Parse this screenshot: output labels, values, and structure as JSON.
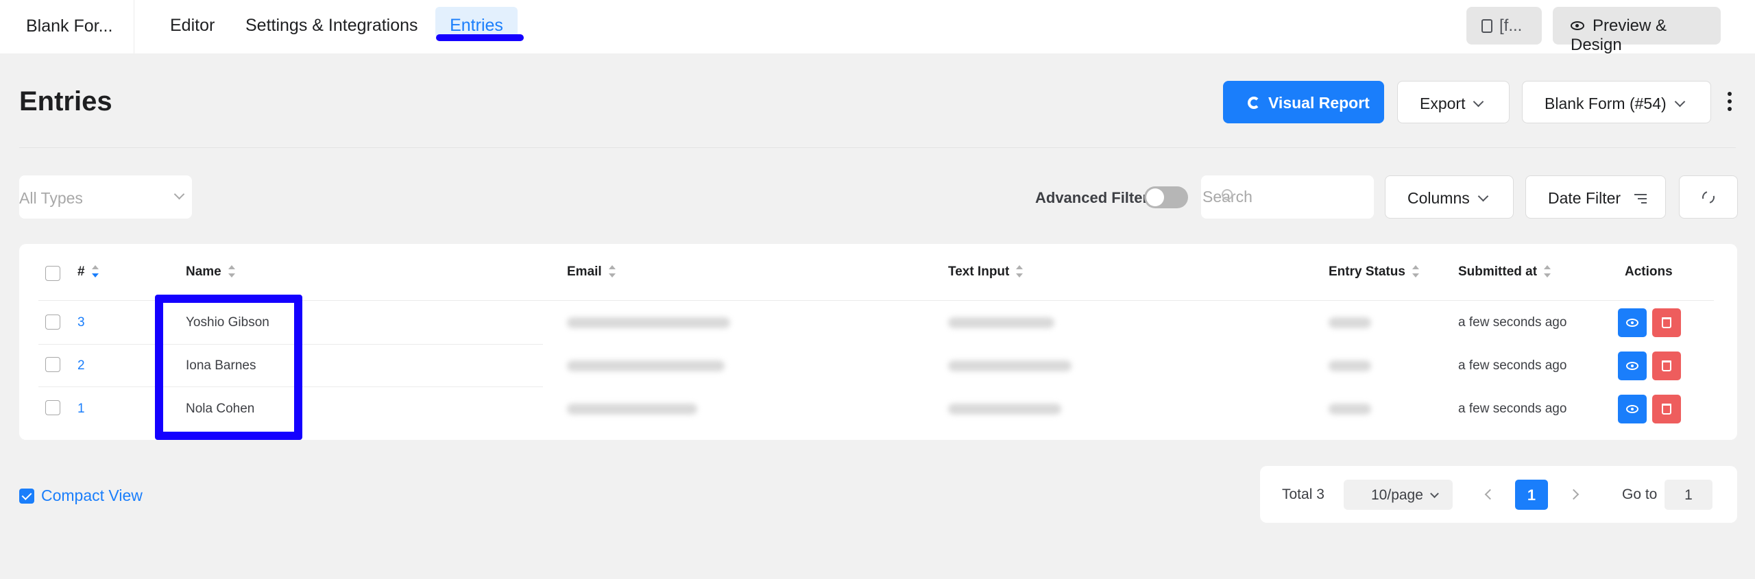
{
  "topnav": {
    "form_name": "Blank For...",
    "tabs": [
      {
        "label": "Editor"
      },
      {
        "label": "Settings & Integrations"
      },
      {
        "label": "Entries",
        "active": true
      }
    ],
    "shortcode_btn": "[f...",
    "preview_btn": "Preview & Design"
  },
  "header": {
    "title": "Entries",
    "visual_report": "Visual Report",
    "export": "Export",
    "form_select": "Blank Form (#54)"
  },
  "filters": {
    "type_select": "All Types",
    "advanced_filter_label": "Advanced Filter",
    "advanced_filter_on": false,
    "search_placeholder": "Search",
    "columns": "Columns",
    "date_filter": "Date Filter"
  },
  "table": {
    "headers": {
      "id": "#",
      "name": "Name",
      "email": "Email",
      "text_input": "Text Input",
      "entry_status": "Entry Status",
      "submitted_at": "Submitted at",
      "actions": "Actions"
    },
    "rows": [
      {
        "id": "3",
        "name": "Yoshio Gibson",
        "submitted": "a few seconds ago"
      },
      {
        "id": "2",
        "name": "Iona Barnes",
        "submitted": "a few seconds ago"
      },
      {
        "id": "1",
        "name": "Nola Cohen",
        "submitted": "a few seconds ago"
      }
    ]
  },
  "footer": {
    "compact_view": "Compact View",
    "compact_checked": true,
    "total": "Total 3",
    "per_page": "10/page",
    "current_page": "1",
    "goto_label": "Go to",
    "goto_value": "1"
  },
  "colors": {
    "primary": "#1a7efb",
    "danger": "#ee5d5d",
    "highlight": "#1400ff"
  }
}
